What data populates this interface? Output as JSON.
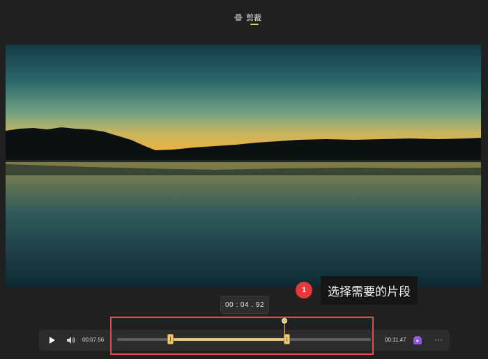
{
  "header": {
    "tab_label": "剪裁",
    "tab_icon": "crop-trim-icon",
    "accent": "#e8c87a"
  },
  "video": {
    "icon": "landscape-lake-sunset-frame"
  },
  "timeline": {
    "current_position_label": "00 : 04 . 92",
    "current_time": "00:07.56",
    "end_time": "00:11.47",
    "selection_start_fraction": 0.21,
    "selection_end_fraction": 0.67,
    "playhead_fraction": 0.66
  },
  "controls": {
    "play_icon": "play-icon",
    "volume_icon": "volume-icon",
    "clip_icon": "video-clip-icon",
    "more_label": "···"
  },
  "callout": {
    "number": "1",
    "text": "选择需要的片段",
    "color": "#e5393b"
  }
}
